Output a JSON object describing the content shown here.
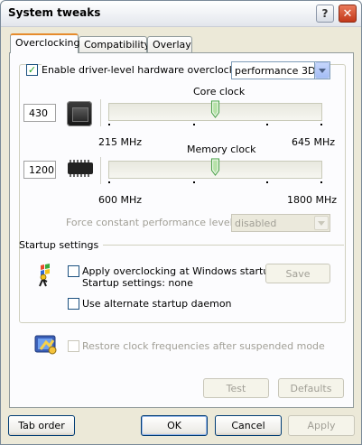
{
  "window": {
    "title": "System tweaks",
    "help_glyph": "?",
    "close_glyph": "✕"
  },
  "tabs": [
    {
      "label": "Overclocking",
      "active": true
    },
    {
      "label": "Compatibility",
      "active": false
    },
    {
      "label": "Overlay",
      "active": false
    }
  ],
  "overclocking": {
    "enable_label": "Enable driver-level hardware overclocking",
    "enable_checked": true,
    "mode_value": "performance 3D",
    "core": {
      "title": "Core clock",
      "value": "430",
      "min_label": "215 MHz",
      "max_label": "645 MHz"
    },
    "memory": {
      "title": "Memory clock",
      "value": "1200",
      "min_label": "600 MHz",
      "max_label": "1800 MHz"
    },
    "force_label": "Force constant performance level",
    "force_value": "disabled"
  },
  "startup": {
    "group_label": "Startup settings",
    "apply_label": "Apply overclocking at Windows startup",
    "apply_checked": false,
    "settings_text": "Startup settings: none",
    "save_label": "Save",
    "alternate_label": "Use alternate startup daemon",
    "alternate_checked": false
  },
  "restore_label": "Restore clock frequencies after suspended mode",
  "panel_buttons": {
    "test": "Test",
    "defaults": "Defaults"
  },
  "footer": {
    "tab_order": "Tab order",
    "ok": "OK",
    "cancel": "Cancel",
    "apply": "Apply"
  }
}
